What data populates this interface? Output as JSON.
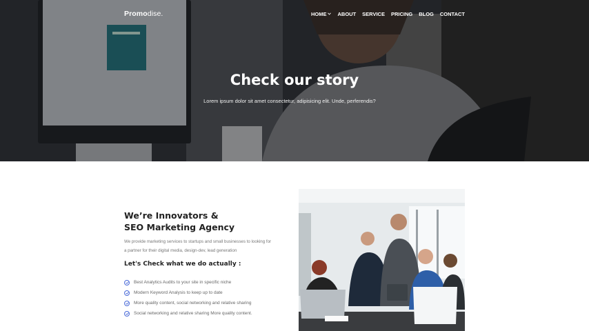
{
  "nav": {
    "logo_bold": "Promo",
    "logo_rest": "dise.",
    "items": [
      {
        "label": "HOME",
        "has_dropdown": true
      },
      {
        "label": "ABOUT",
        "has_dropdown": false
      },
      {
        "label": "SERVICE",
        "has_dropdown": false
      },
      {
        "label": "PRICING",
        "has_dropdown": false
      },
      {
        "label": "BLOG",
        "has_dropdown": false
      },
      {
        "label": "CONTACT",
        "has_dropdown": false
      }
    ]
  },
  "hero": {
    "title": "Check our story",
    "subtitle": "Lorem ipsum dolor sit amet consectetur, adipisicing elit. Unde, perferendis?"
  },
  "about": {
    "heading_line1": "We’re Innovators &",
    "heading_line2": "SEO Marketing Agency",
    "description_line1": "We provide marketing services to startups and small businesses to looking for",
    "description_line2": "a partner for their digital media, design-dev, lead generation",
    "check_heading": "Let's Check what we do actually :",
    "features": [
      "Best Analytics Audits to your site in specific niche",
      "Modern Keyword Analysis to keep up to date",
      "More quality content, social networking and relative sharing",
      "Social networking and relative sharing More quality content."
    ]
  },
  "colors": {
    "accent": "#4a6bd8",
    "heading": "#222222",
    "body_text": "#777777"
  }
}
